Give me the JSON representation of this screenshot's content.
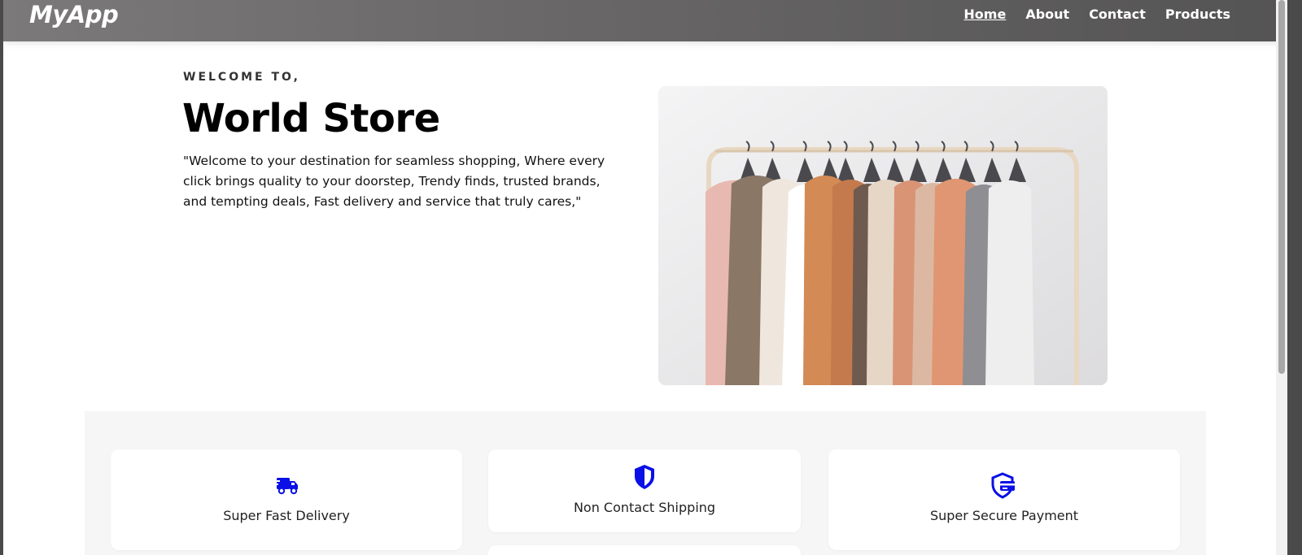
{
  "navbar": {
    "logo": "MyApp",
    "links": [
      {
        "label": "Home",
        "active": true
      },
      {
        "label": "About",
        "active": false
      },
      {
        "label": "Contact",
        "active": false
      },
      {
        "label": "Products",
        "active": false
      }
    ]
  },
  "hero": {
    "kicker": "WELCOME TO,",
    "title": "World Store",
    "text": "\"Welcome to your destination for seamless shopping, Where every click brings quality to your doorstep, Trendy finds, trusted brands, and tempting deals, Fast delivery and service that truly cares,\""
  },
  "features": [
    {
      "label": "Super Fast Delivery",
      "icon": "truck-icon"
    },
    {
      "label": "Non Contact Shipping",
      "icon": "shield-icon"
    },
    {
      "label": "Super Secure Payment",
      "icon": "secure-card-icon"
    }
  ],
  "colors": {
    "accent": "#0a10e6",
    "navbar": "#6a6868"
  }
}
